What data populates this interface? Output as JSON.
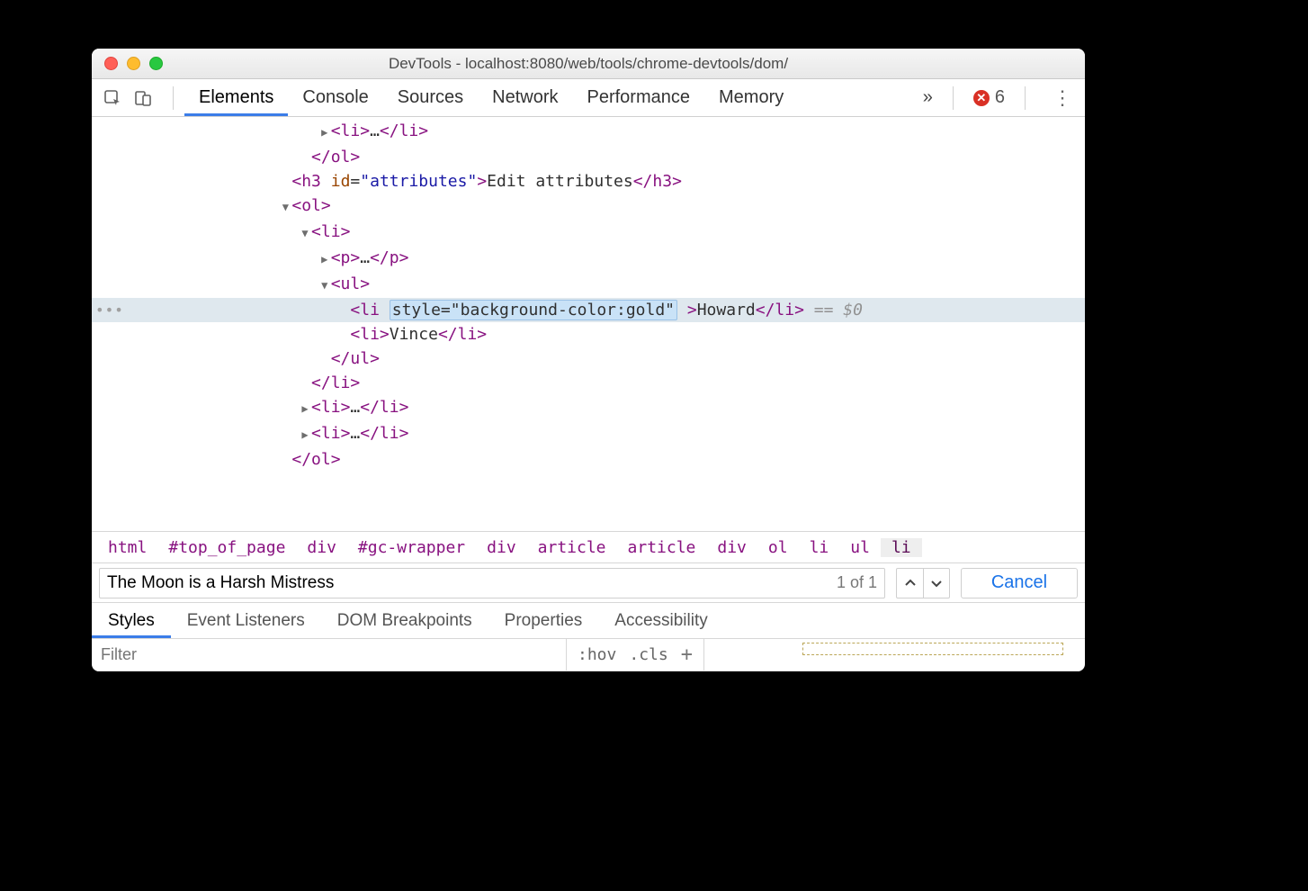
{
  "window": {
    "title": "DevTools - localhost:8080/web/tools/chrome-devtools/dom/"
  },
  "toolbar": {
    "tabs": [
      "Elements",
      "Console",
      "Sources",
      "Network",
      "Performance",
      "Memory"
    ],
    "active_tab": "Elements",
    "error_count": "6",
    "more_glyph": "»"
  },
  "dom_lines": [
    {
      "indent": 7,
      "arrow": "right",
      "pre": "<li>",
      "mid": "…",
      "post": "</li>",
      "sel": false
    },
    {
      "indent": 6,
      "arrow": "",
      "pre": "</ol>",
      "mid": "",
      "post": "",
      "sel": false
    },
    {
      "indent": 5,
      "arrow": "",
      "html": "<h3 id=\"attributes\">Edit attributes</h3>",
      "sel": false
    },
    {
      "indent": 5,
      "arrow": "down",
      "pre": "<ol>",
      "mid": "",
      "post": "",
      "sel": false
    },
    {
      "indent": 6,
      "arrow": "down",
      "pre": "<li>",
      "mid": "",
      "post": "",
      "sel": false
    },
    {
      "indent": 7,
      "arrow": "right",
      "pre": "<p>",
      "mid": "…",
      "post": "</p>",
      "sel": false
    },
    {
      "indent": 7,
      "arrow": "down",
      "pre": "<ul>",
      "mid": "",
      "post": "",
      "sel": false
    },
    {
      "indent": 8,
      "arrow": "",
      "selected": true,
      "edit_attr": "style=\"background-color:gold\"",
      "text": "Howard",
      "ref": " == $0"
    },
    {
      "indent": 8,
      "arrow": "",
      "pre": "<li>",
      "mid": "Vince",
      "post": "</li>",
      "sel": false
    },
    {
      "indent": 7,
      "arrow": "",
      "pre": "</ul>",
      "mid": "",
      "post": "",
      "sel": false
    },
    {
      "indent": 6,
      "arrow": "",
      "pre": "</li>",
      "mid": "",
      "post": "",
      "sel": false
    },
    {
      "indent": 6,
      "arrow": "right",
      "pre": "<li>",
      "mid": "…",
      "post": "</li>",
      "sel": false
    },
    {
      "indent": 6,
      "arrow": "right",
      "pre": "<li>",
      "mid": "…",
      "post": "</li>",
      "sel": false
    },
    {
      "indent": 5,
      "arrow": "",
      "pre": "</ol>",
      "mid": "",
      "post": "",
      "sel": false
    }
  ],
  "breadcrumb": [
    "html",
    "#top_of_page",
    "div",
    "#gc-wrapper",
    "div",
    "article",
    "article",
    "div",
    "ol",
    "li",
    "ul",
    "li"
  ],
  "breadcrumb_selected_index": 11,
  "search": {
    "value": "The Moon is a Harsh Mistress",
    "count": "1 of 1",
    "cancel": "Cancel"
  },
  "subtabs": [
    "Styles",
    "Event Listeners",
    "DOM Breakpoints",
    "Properties",
    "Accessibility"
  ],
  "subtabs_active": "Styles",
  "styles_row": {
    "filter_placeholder": "Filter",
    "hov": ":hov",
    "cls": ".cls"
  }
}
